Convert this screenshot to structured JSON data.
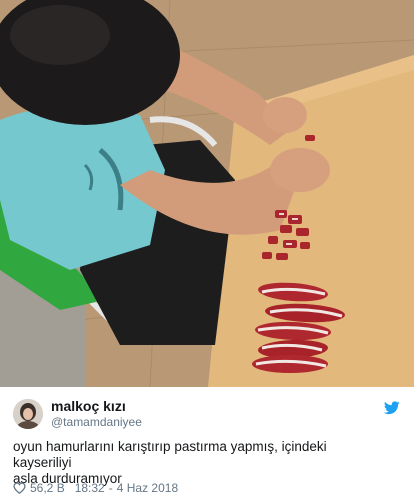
{
  "tweet": {
    "display_name": "malkoç kızı",
    "handle": "@tamamdaniyee",
    "text_line1": "oyun hamurlarını karıştırıp pastırma yapmış, içindeki kayseriliyi",
    "text_line2": "asla durduramıyor",
    "likes": "56,2 B",
    "time": "18:32",
    "date": "4 Haz 2018"
  },
  "icons": {
    "avatar": "user-avatar",
    "platform": "twitter-bird-icon",
    "like": "heart-icon"
  },
  "colors": {
    "brand": "#1da1f2",
    "text": "#14171a",
    "secondary": "#657786"
  }
}
